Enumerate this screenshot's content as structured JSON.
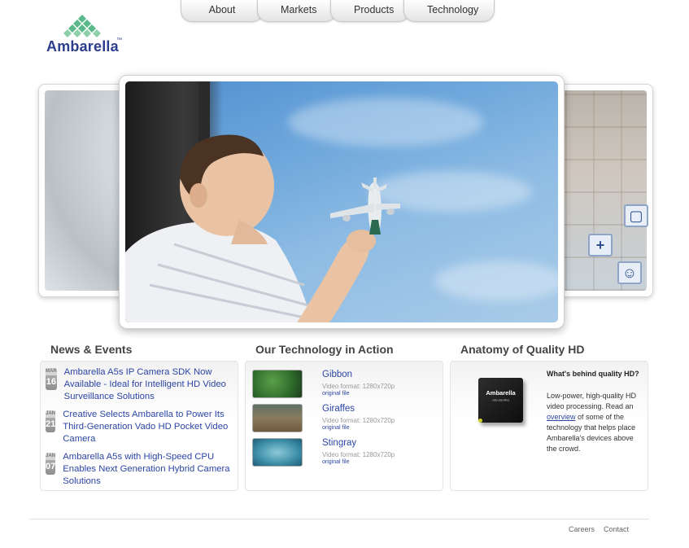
{
  "nav": {
    "items": [
      {
        "label": "About"
      },
      {
        "label": "Markets"
      },
      {
        "label": "Products"
      },
      {
        "label": "Technology"
      }
    ]
  },
  "logo": {
    "text": "Ambarella",
    "tm": "™",
    "color": "#2b3d8c",
    "mark_color": "#5bb88a"
  },
  "sections": {
    "news_title": "News & Events",
    "tech_title": "Our Technology in Action",
    "anatomy_title": "Anatomy of Quality HD"
  },
  "news": [
    {
      "month": "MAR",
      "day": "16",
      "title": "Ambarella A5s IP Camera SDK Now Available - Ideal for Intelligent HD Video Surveillance Solutions"
    },
    {
      "month": "JAN",
      "day": "21",
      "title": "Creative Selects Ambarella to Power Its Third-Generation Vado HD Pocket Video Camera"
    },
    {
      "month": "JAN",
      "day": "07",
      "title": "Ambarella A5s with High-Speed CPU Enables Next Generation Hybrid Camera Solutions"
    }
  ],
  "videos": [
    {
      "title": "Gibbon",
      "format": "Video format: 1280x720p",
      "link": "original file"
    },
    {
      "title": "Giraffes",
      "format": "Video format: 1280x720p",
      "link": "original file"
    },
    {
      "title": "Stingray",
      "format": "Video format: 1280x720p",
      "link": "original file"
    }
  ],
  "anatomy": {
    "question": "What's behind quality HD?",
    "text_before": "Low-power, high-quality HD video processing. Read an ",
    "link": "overview",
    "text_after": " of some of the technology that helps place Ambarella's devices above the crowd.",
    "chip_brand": "Ambarella",
    "chip_code": "A5-A5-RH"
  },
  "footer": {
    "careers": "Careers",
    "contact": "Contact"
  },
  "colors": {
    "link": "#2c45a5",
    "heading": "#444444"
  }
}
